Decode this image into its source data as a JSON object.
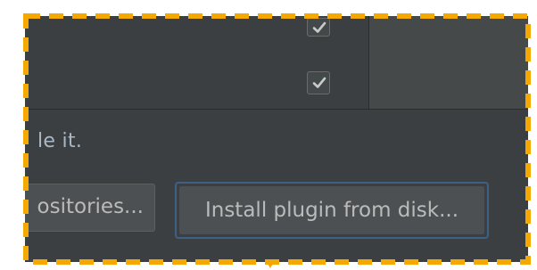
{
  "plugins": {
    "rows": [
      {
        "enabled": true
      },
      {
        "enabled": true
      }
    ]
  },
  "hint": {
    "text": "le it."
  },
  "buttons": {
    "repositories_label": "ositories...",
    "install_from_disk_label": "Install plugin from disk..."
  },
  "colors": {
    "panel_background": "#3c3f41",
    "details_background": "#45494a",
    "button_background": "#4c5052",
    "button_text": "#bbbbbb",
    "focus_ring": "#3d6185",
    "highlight_border": "#f5a800"
  },
  "icons": {
    "checkbox_mark": "checkmark-icon"
  }
}
